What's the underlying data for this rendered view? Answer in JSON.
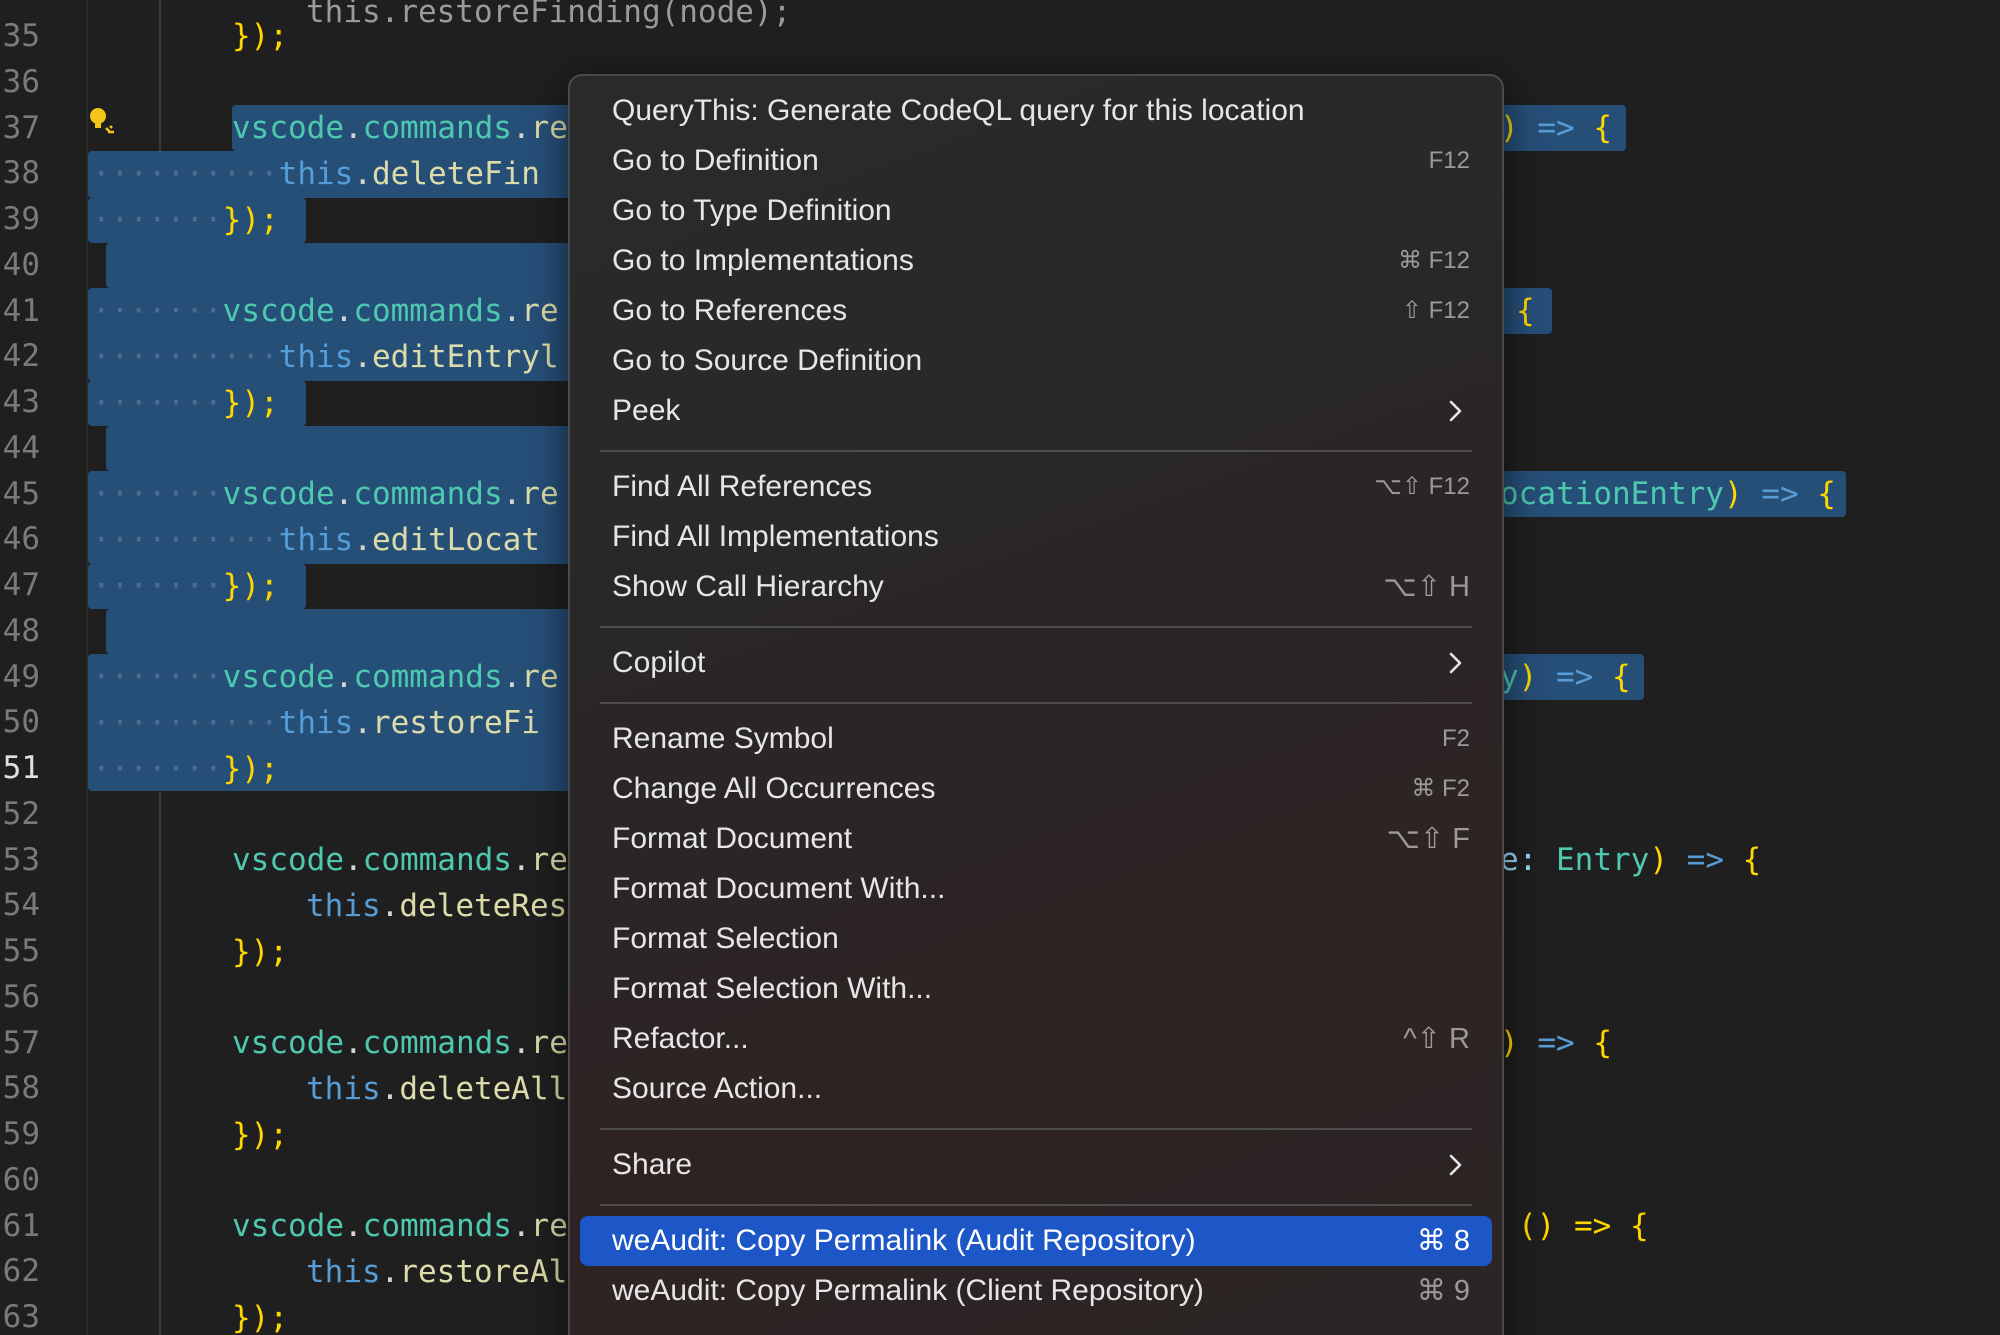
{
  "editor": {
    "active_line": "51",
    "lines": [
      {
        "num": "35"
      },
      {
        "num": "36"
      },
      {
        "num": "37"
      },
      {
        "num": "38"
      },
      {
        "num": "39"
      },
      {
        "num": "40"
      },
      {
        "num": "41"
      },
      {
        "num": "42"
      },
      {
        "num": "43"
      },
      {
        "num": "44"
      },
      {
        "num": "45"
      },
      {
        "num": "46"
      },
      {
        "num": "47"
      },
      {
        "num": "48"
      },
      {
        "num": "49"
      },
      {
        "num": "50"
      },
      {
        "num": "51"
      },
      {
        "num": "52"
      },
      {
        "num": "53"
      },
      {
        "num": "54"
      },
      {
        "num": "55"
      },
      {
        "num": "56"
      },
      {
        "num": "57"
      },
      {
        "num": "58"
      },
      {
        "num": "59"
      },
      {
        "num": "60"
      },
      {
        "num": "61"
      },
      {
        "num": "62"
      },
      {
        "num": "63"
      }
    ],
    "code": {
      "closer": "});",
      "vscode": "vscode",
      "dot": ".",
      "commands": "commands",
      "re": "re",
      "this": "this",
      "deleteFin": "deleteFin",
      "editEntry": "editEntryl",
      "editLocat": "editLocat",
      "restoreFi": "restoreFi",
      "deleteRes": "deleteRes",
      "deleteAll": "deleteAll",
      "restoreAl": "restoreAl",
      "arrow_open": ") => {",
      "brace_only": "{",
      "location_entry": "ocationEntry",
      "y": "y",
      "e_colon": "e: ",
      "entry": "Entry",
      "empty_parens": "() => {",
      "top_partial": "this.restoreFinding(node);",
      "ws_dots": "·······",
      "ws_dots_short": "···"
    },
    "colors": {
      "background": "#1f1f1f",
      "selection": "#264f78"
    }
  },
  "menu": {
    "items": [
      {
        "label": "QueryThis: Generate CodeQL query for this location",
        "key": ""
      },
      {
        "label": "Go to Definition",
        "key": "F12"
      },
      {
        "label": "Go to Type Definition",
        "key": ""
      },
      {
        "label": "Go to Implementations",
        "key": "⌘ F12"
      },
      {
        "label": "Go to References",
        "key": "⇧ F12"
      },
      {
        "label": "Go to Source Definition",
        "key": ""
      },
      {
        "label": "Peek",
        "key": "",
        "submenu": true
      },
      {
        "label": "Find All References",
        "key": "⌥⇧ F12"
      },
      {
        "label": "Find All Implementations",
        "key": ""
      },
      {
        "label": "Show Call Hierarchy",
        "key": "⌥⇧ H"
      },
      {
        "label": "Copilot",
        "key": "",
        "submenu": true
      },
      {
        "label": "Rename Symbol",
        "key": "F2"
      },
      {
        "label": "Change All Occurrences",
        "key": "⌘ F2"
      },
      {
        "label": "Format Document",
        "key": "⌥⇧ F"
      },
      {
        "label": "Format Document With...",
        "key": ""
      },
      {
        "label": "Format Selection",
        "key": ""
      },
      {
        "label": "Format Selection With...",
        "key": ""
      },
      {
        "label": "Refactor...",
        "key": "^⇧ R"
      },
      {
        "label": "Source Action...",
        "key": ""
      },
      {
        "label": "Share",
        "key": "",
        "submenu": true
      },
      {
        "label": "weAudit: Copy Permalink (Audit Repository)",
        "key": "⌘ 8",
        "highlighted": true
      },
      {
        "label": "weAudit: Copy Permalink (Client Repository)",
        "key": "⌘ 9"
      }
    ],
    "colors": {
      "highlight": "#1d56c7",
      "text": "#e6e6e6",
      "shortcut": "#9a9a9a"
    }
  }
}
